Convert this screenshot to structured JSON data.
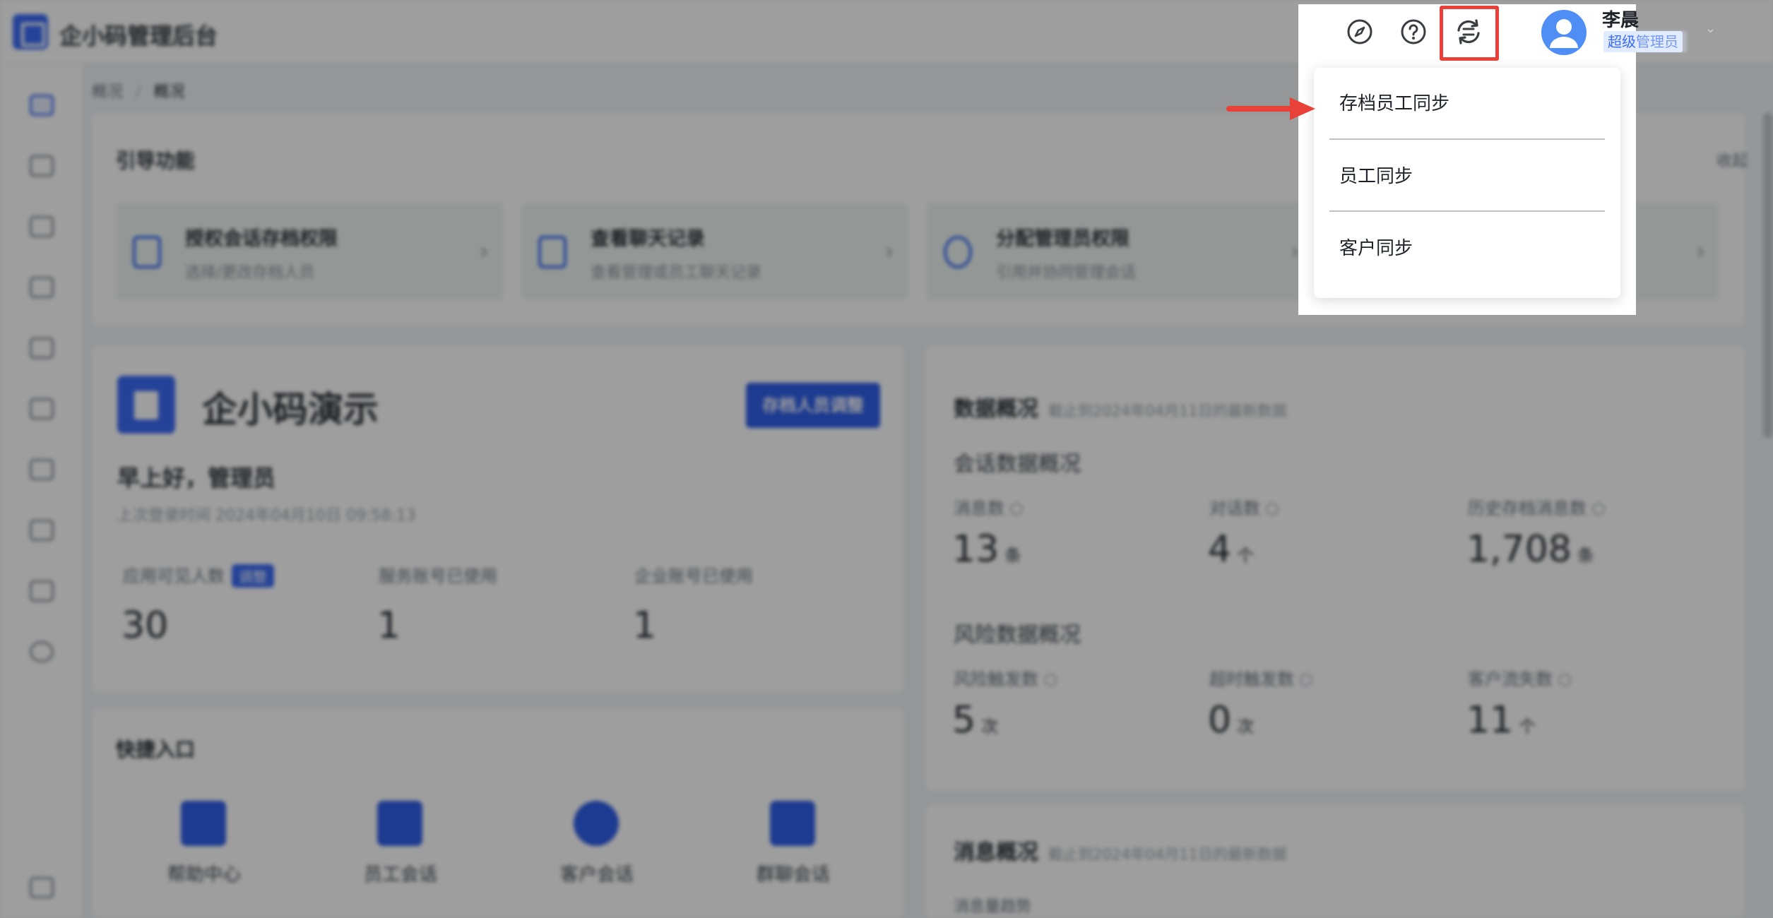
{
  "app": {
    "title": "企小码管理后台"
  },
  "breadcrumb": {
    "home": "概况",
    "current": "概况"
  },
  "guide": {
    "title": "引导功能",
    "collapse": "收起",
    "items": [
      {
        "title": "授权会话存档权限",
        "subtitle": "选择/更改存档人员"
      },
      {
        "title": "查看聊天记录",
        "subtitle": "查看管理或员工聊天记录"
      },
      {
        "title": "分配管理员权限",
        "subtitle": "引用并协同管理会话"
      }
    ]
  },
  "org": {
    "name": "企小码演示",
    "button": "存档人员调整",
    "greeting": "早上好，管理员",
    "last_login": "上次登录时间 2024年04月10日 09:58:13",
    "stats": [
      {
        "label": "应用可见人数",
        "badge": "调整",
        "value": "30"
      },
      {
        "label": "服务账号已使用",
        "value": "1"
      },
      {
        "label": "企业账号已使用",
        "value": "1"
      }
    ]
  },
  "data_overview": {
    "title": "数据概况",
    "subtitle": "截止到2024年04月11日的最新数据",
    "session_title": "会话数据概况",
    "session_stats": [
      {
        "label": "消息数",
        "value": "13",
        "unit": "条"
      },
      {
        "label": "对话数",
        "value": "4",
        "unit": "个"
      },
      {
        "label": "历史存档消息数",
        "value": "1,708",
        "unit": "条"
      }
    ],
    "risk_title": "风险数据概况",
    "risk_stats": [
      {
        "label": "风险触发数",
        "value": "5",
        "unit": "次"
      },
      {
        "label": "超时触发数",
        "value": "0",
        "unit": "次"
      },
      {
        "label": "客户流失数",
        "value": "11",
        "unit": "个"
      }
    ]
  },
  "quick": {
    "title": "快捷入口",
    "items": [
      "帮助中心",
      "员工会话",
      "客户会话",
      "群聊会话"
    ]
  },
  "message_overview": {
    "title": "消息概况",
    "subtitle": "截止到2024年04月11日的最新数据",
    "trend_label": "消息量趋势"
  },
  "header": {
    "icons": [
      "compass-icon",
      "help-icon",
      "sync-icon"
    ],
    "user": {
      "name": "李晨",
      "role": "超级管理员"
    }
  },
  "sync_menu": {
    "items": [
      "存档员工同步",
      "员工同步",
      "客户同步"
    ]
  },
  "colors": {
    "accent": "#3b6cf5",
    "highlight": "#e8413a"
  }
}
